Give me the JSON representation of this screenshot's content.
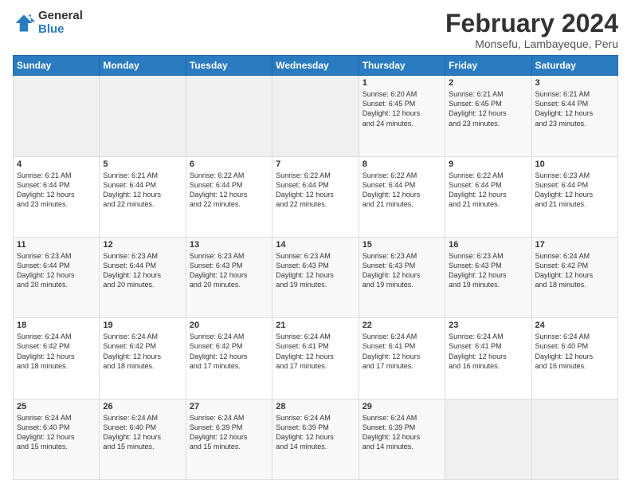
{
  "logo": {
    "general": "General",
    "blue": "Blue"
  },
  "header": {
    "title": "February 2024",
    "location": "Monsefu, Lambayeque, Peru"
  },
  "weekdays": [
    "Sunday",
    "Monday",
    "Tuesday",
    "Wednesday",
    "Thursday",
    "Friday",
    "Saturday"
  ],
  "weeks": [
    [
      {
        "day": "",
        "info": ""
      },
      {
        "day": "",
        "info": ""
      },
      {
        "day": "",
        "info": ""
      },
      {
        "day": "",
        "info": ""
      },
      {
        "day": "1",
        "info": "Sunrise: 6:20 AM\nSunset: 6:45 PM\nDaylight: 12 hours\nand 24 minutes."
      },
      {
        "day": "2",
        "info": "Sunrise: 6:21 AM\nSunset: 6:45 PM\nDaylight: 12 hours\nand 23 minutes."
      },
      {
        "day": "3",
        "info": "Sunrise: 6:21 AM\nSunset: 6:44 PM\nDaylight: 12 hours\nand 23 minutes."
      }
    ],
    [
      {
        "day": "4",
        "info": "Sunrise: 6:21 AM\nSunset: 6:44 PM\nDaylight: 12 hours\nand 23 minutes."
      },
      {
        "day": "5",
        "info": "Sunrise: 6:21 AM\nSunset: 6:44 PM\nDaylight: 12 hours\nand 22 minutes."
      },
      {
        "day": "6",
        "info": "Sunrise: 6:22 AM\nSunset: 6:44 PM\nDaylight: 12 hours\nand 22 minutes."
      },
      {
        "day": "7",
        "info": "Sunrise: 6:22 AM\nSunset: 6:44 PM\nDaylight: 12 hours\nand 22 minutes."
      },
      {
        "day": "8",
        "info": "Sunrise: 6:22 AM\nSunset: 6:44 PM\nDaylight: 12 hours\nand 21 minutes."
      },
      {
        "day": "9",
        "info": "Sunrise: 6:22 AM\nSunset: 6:44 PM\nDaylight: 12 hours\nand 21 minutes."
      },
      {
        "day": "10",
        "info": "Sunrise: 6:23 AM\nSunset: 6:44 PM\nDaylight: 12 hours\nand 21 minutes."
      }
    ],
    [
      {
        "day": "11",
        "info": "Sunrise: 6:23 AM\nSunset: 6:44 PM\nDaylight: 12 hours\nand 20 minutes."
      },
      {
        "day": "12",
        "info": "Sunrise: 6:23 AM\nSunset: 6:44 PM\nDaylight: 12 hours\nand 20 minutes."
      },
      {
        "day": "13",
        "info": "Sunrise: 6:23 AM\nSunset: 6:43 PM\nDaylight: 12 hours\nand 20 minutes."
      },
      {
        "day": "14",
        "info": "Sunrise: 6:23 AM\nSunset: 6:43 PM\nDaylight: 12 hours\nand 19 minutes."
      },
      {
        "day": "15",
        "info": "Sunrise: 6:23 AM\nSunset: 6:43 PM\nDaylight: 12 hours\nand 19 minutes."
      },
      {
        "day": "16",
        "info": "Sunrise: 6:23 AM\nSunset: 6:43 PM\nDaylight: 12 hours\nand 19 minutes."
      },
      {
        "day": "17",
        "info": "Sunrise: 6:24 AM\nSunset: 6:42 PM\nDaylight: 12 hours\nand 18 minutes."
      }
    ],
    [
      {
        "day": "18",
        "info": "Sunrise: 6:24 AM\nSunset: 6:42 PM\nDaylight: 12 hours\nand 18 minutes."
      },
      {
        "day": "19",
        "info": "Sunrise: 6:24 AM\nSunset: 6:42 PM\nDaylight: 12 hours\nand 18 minutes."
      },
      {
        "day": "20",
        "info": "Sunrise: 6:24 AM\nSunset: 6:42 PM\nDaylight: 12 hours\nand 17 minutes."
      },
      {
        "day": "21",
        "info": "Sunrise: 6:24 AM\nSunset: 6:41 PM\nDaylight: 12 hours\nand 17 minutes."
      },
      {
        "day": "22",
        "info": "Sunrise: 6:24 AM\nSunset: 6:41 PM\nDaylight: 12 hours\nand 17 minutes."
      },
      {
        "day": "23",
        "info": "Sunrise: 6:24 AM\nSunset: 6:41 PM\nDaylight: 12 hours\nand 16 minutes."
      },
      {
        "day": "24",
        "info": "Sunrise: 6:24 AM\nSunset: 6:40 PM\nDaylight: 12 hours\nand 16 minutes."
      }
    ],
    [
      {
        "day": "25",
        "info": "Sunrise: 6:24 AM\nSunset: 6:40 PM\nDaylight: 12 hours\nand 15 minutes."
      },
      {
        "day": "26",
        "info": "Sunrise: 6:24 AM\nSunset: 6:40 PM\nDaylight: 12 hours\nand 15 minutes."
      },
      {
        "day": "27",
        "info": "Sunrise: 6:24 AM\nSunset: 6:39 PM\nDaylight: 12 hours\nand 15 minutes."
      },
      {
        "day": "28",
        "info": "Sunrise: 6:24 AM\nSunset: 6:39 PM\nDaylight: 12 hours\nand 14 minutes."
      },
      {
        "day": "29",
        "info": "Sunrise: 6:24 AM\nSunset: 6:39 PM\nDaylight: 12 hours\nand 14 minutes."
      },
      {
        "day": "",
        "info": ""
      },
      {
        "day": "",
        "info": ""
      }
    ]
  ]
}
